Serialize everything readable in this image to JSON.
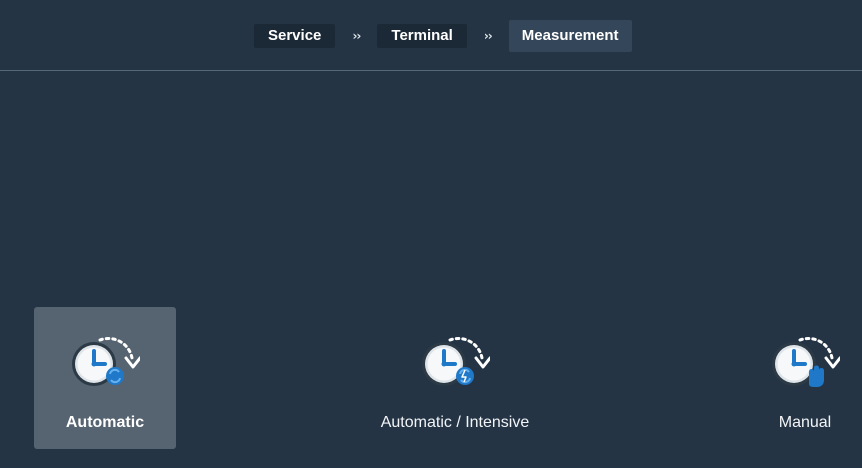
{
  "breadcrumb": {
    "items": [
      "Service",
      "Terminal",
      "Measurement"
    ],
    "separator": "››",
    "active_index": 2
  },
  "modes": [
    {
      "label": "Automatic",
      "icon": "clock-automatic-icon",
      "selected": true
    },
    {
      "label": "Automatic / Intensive",
      "icon": "clock-automatic-intensive-icon",
      "selected": false
    },
    {
      "label": "Manual",
      "icon": "clock-manual-icon",
      "selected": false
    }
  ],
  "colors": {
    "background": "#243444",
    "selected_tile": "#566370",
    "accent_blue": "#1f78c8"
  }
}
